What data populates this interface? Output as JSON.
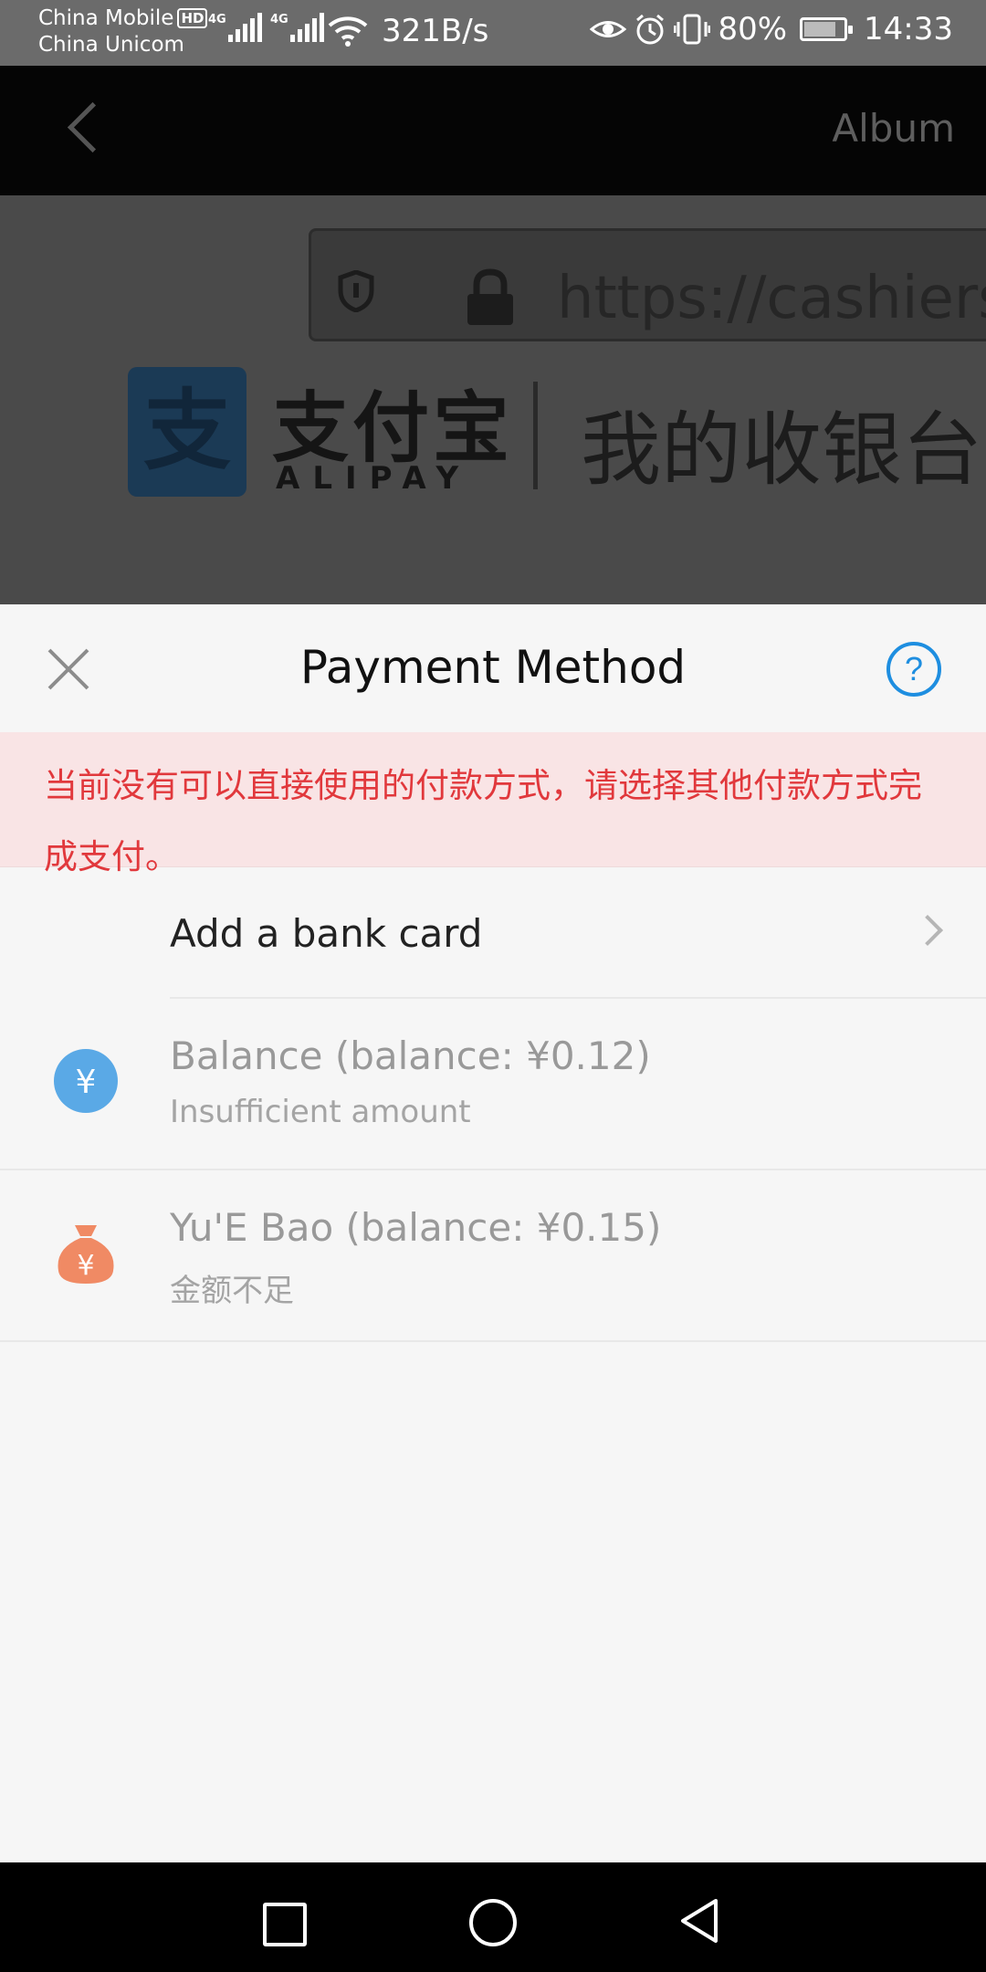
{
  "status_bar": {
    "carrier_1": "China Mobile",
    "hd_badge": "HD",
    "carrier_2": "China Unicom",
    "network_1": "4G",
    "network_2": "4G",
    "net_speed": "321B/s",
    "battery": "80%",
    "battery_level": 0.8,
    "time": "14:33"
  },
  "webview": {
    "header_right": "Album",
    "url": "https://cashiers",
    "brand_cn": "支付宝",
    "brand_en": "ALIPAY",
    "page_title": "我的收银台",
    "brand_color": "#1b3a55"
  },
  "sheet": {
    "title": "Payment Method",
    "warning": "当前没有可以直接使用的付款方式，请选择其他付款方式完成支付。",
    "add_card_label": "Add a bank card",
    "options": [
      {
        "title": "Balance (balance: ¥0.12)",
        "subtitle": "Insufficient amount",
        "icon": "yuan-coin-icon",
        "color": "#5aa9e6"
      },
      {
        "title": "Yu'E Bao (balance: ¥0.15)",
        "subtitle": "金额不足",
        "icon": "money-bag-icon",
        "color": "#f08a64"
      }
    ],
    "accent_color": "#1e8ee0",
    "warning_color": "#e1383c"
  }
}
